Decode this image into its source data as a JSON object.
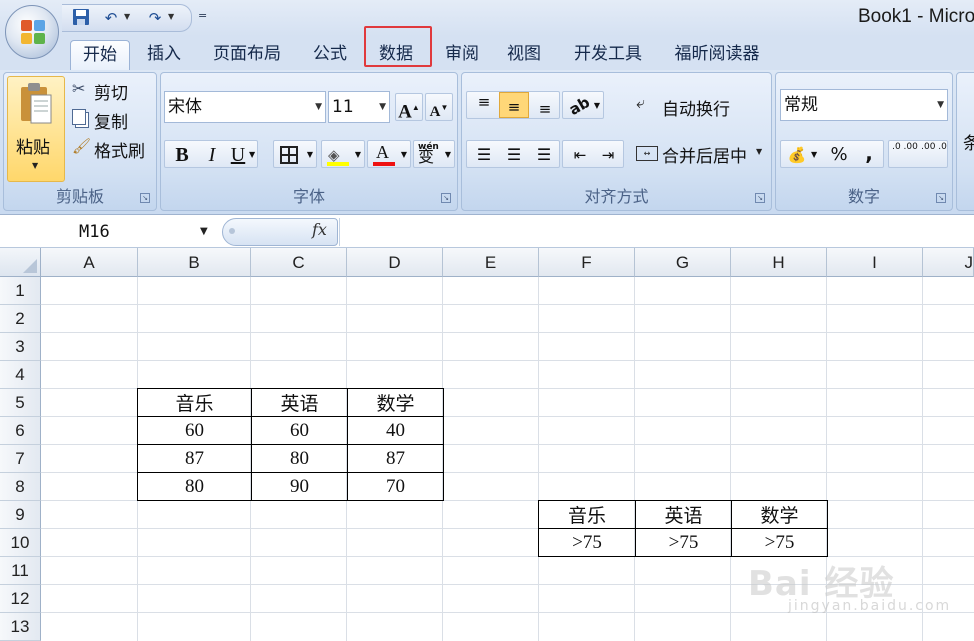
{
  "titlebar": {
    "title": "Book1 - Micro",
    "qat_customize": "="
  },
  "tabs": [
    {
      "label": "开始",
      "active": true
    },
    {
      "label": "插入"
    },
    {
      "label": "页面布局"
    },
    {
      "label": "公式"
    },
    {
      "label": "数据",
      "highlighted": true
    },
    {
      "label": "审阅"
    },
    {
      "label": "视图"
    },
    {
      "label": "开发工具"
    },
    {
      "label": "福昕阅读器"
    }
  ],
  "ribbon": {
    "clipboard": {
      "label": "剪贴板",
      "paste": "粘贴",
      "cut": "剪切",
      "copy": "复制",
      "format_painter": "格式刷"
    },
    "font": {
      "label": "字体",
      "font_name": "宋体",
      "font_size": "11",
      "grow": "A",
      "shrink": "A",
      "bold": "B",
      "italic": "I",
      "underline": "U",
      "font_color": "A",
      "phonetic": "wén",
      "phonetic_char": "变"
    },
    "alignment": {
      "label": "对齐方式",
      "wrap_text": "自动换行",
      "merge_center": "合并后居中"
    },
    "number": {
      "label": "数字",
      "format": "常规",
      "percent": "%",
      "comma": ",",
      "inc_decimal": ".0 .00",
      "dec_decimal": ".00 .0"
    },
    "styles": {
      "partial_label": "条"
    }
  },
  "formula_bar": {
    "name_box": "M16",
    "fx": "fx",
    "formula": ""
  },
  "sheet": {
    "columns": [
      "A",
      "B",
      "C",
      "D",
      "E",
      "F",
      "G",
      "H",
      "I",
      "J"
    ],
    "rows": [
      "1",
      "2",
      "3",
      "4",
      "5",
      "6",
      "7",
      "8",
      "9",
      "10",
      "11",
      "12",
      "13"
    ],
    "table1": {
      "headers": [
        "音乐",
        "英语",
        "数学"
      ],
      "rows": [
        [
          "60",
          "60",
          "40"
        ],
        [
          "87",
          "80",
          "87"
        ],
        [
          "80",
          "90",
          "70"
        ]
      ]
    },
    "table2": {
      "headers": [
        "音乐",
        "英语",
        "数学"
      ],
      "rows": [
        [
          ">75",
          ">75",
          ">75"
        ]
      ]
    }
  },
  "watermark": {
    "main": "Bai 经验",
    "sub": "jingyan.baidu.com"
  },
  "colors": {
    "highlight": "#e0393d",
    "ribbon_bg": "#d5e1f2",
    "grid_line": "#dadfe6"
  }
}
